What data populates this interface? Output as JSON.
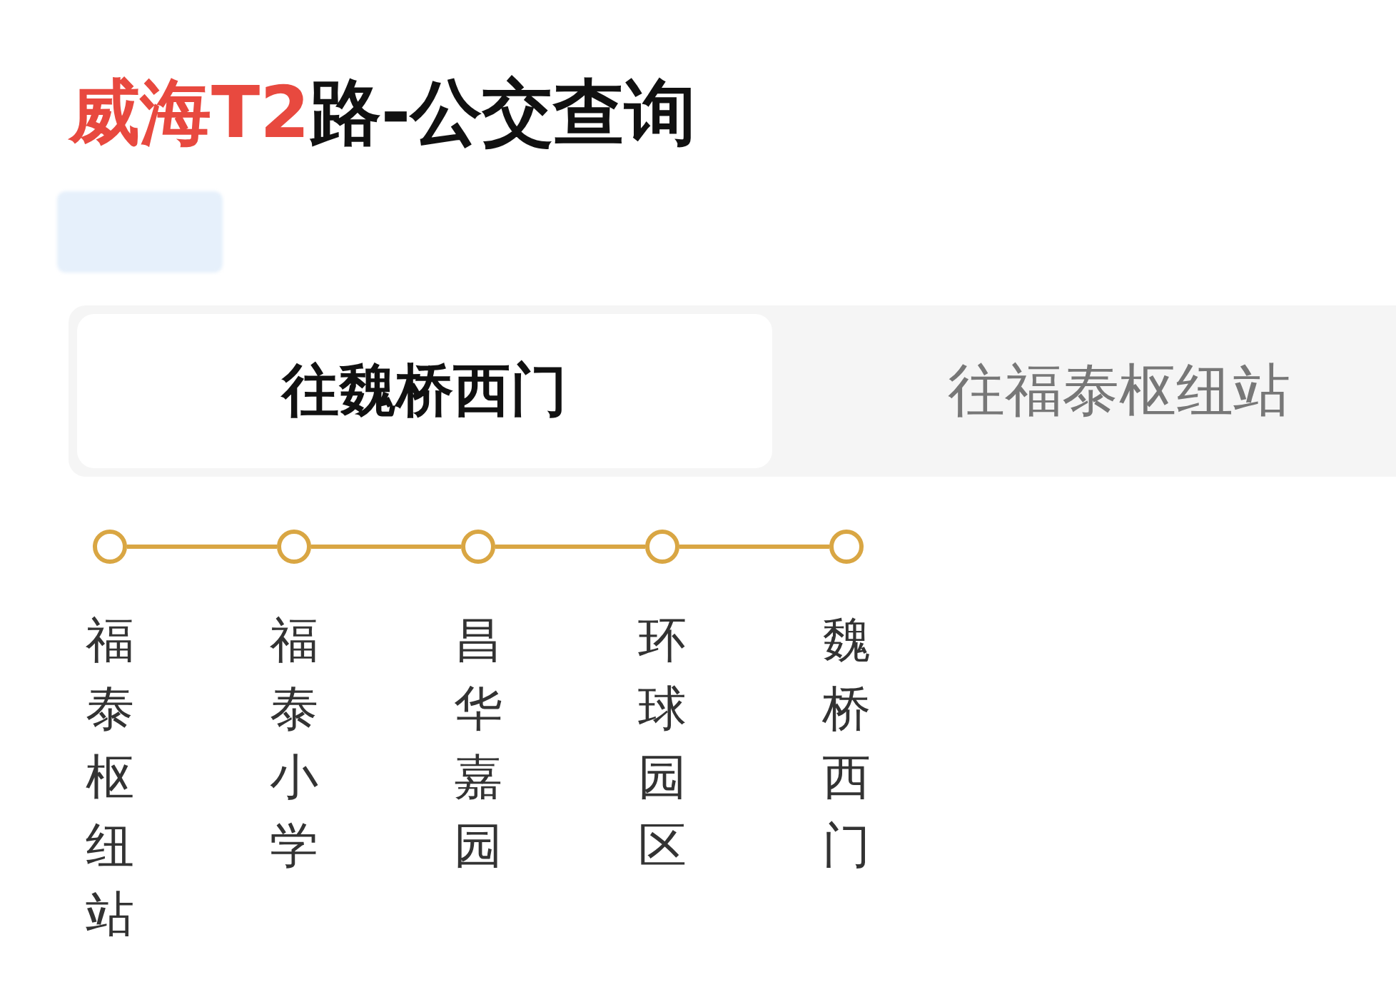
{
  "title": {
    "highlight": "威海T2",
    "rest": "路-公交查询"
  },
  "tabs": [
    {
      "label": "往魏桥西门",
      "selected": true
    },
    {
      "label": "往福泰枢纽站",
      "selected": false
    }
  ],
  "stations": [
    {
      "name": "福泰枢纽站"
    },
    {
      "name": "福泰小学"
    },
    {
      "name": "昌华嘉园"
    },
    {
      "name": "环球园区"
    },
    {
      "name": "魏桥西门"
    }
  ]
}
